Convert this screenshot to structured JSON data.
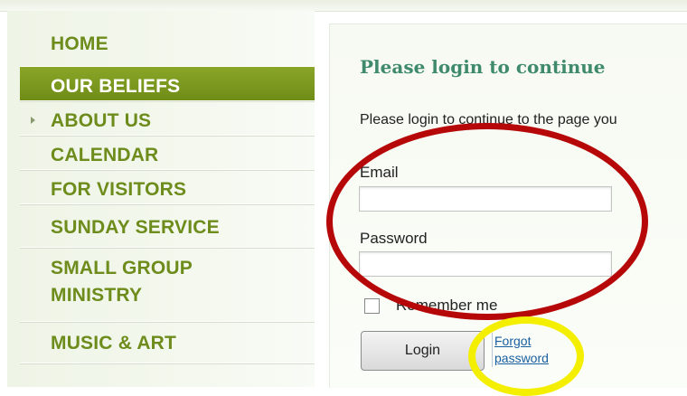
{
  "nav": {
    "items": [
      {
        "label": "HOME"
      },
      {
        "label": "OUR BELIEFS",
        "active": true
      },
      {
        "label": "ABOUT US",
        "has_submenu": true
      },
      {
        "label": "CALENDAR"
      },
      {
        "label": "FOR VISITORS"
      },
      {
        "label": "SUNDAY SERVICE"
      },
      {
        "label": "SMALL GROUP MINISTRY"
      },
      {
        "label": "MUSIC & ART"
      }
    ]
  },
  "login": {
    "title": "Please login to continue",
    "intro": "Please login to continue to the page you",
    "email_label": "Email",
    "email_value": "",
    "password_label": "Password",
    "password_value": "",
    "remember_label": "Remember me",
    "remember_checked": false,
    "login_button": "Login",
    "forgot_line1": "Forgot",
    "forgot_line2": "password"
  },
  "colors": {
    "nav_text": "#6d8c1b",
    "nav_active_bg": "#7a961f",
    "title": "#3f8a6c",
    "annotation_red": "#b60808",
    "annotation_yellow": "#f4ee00"
  }
}
